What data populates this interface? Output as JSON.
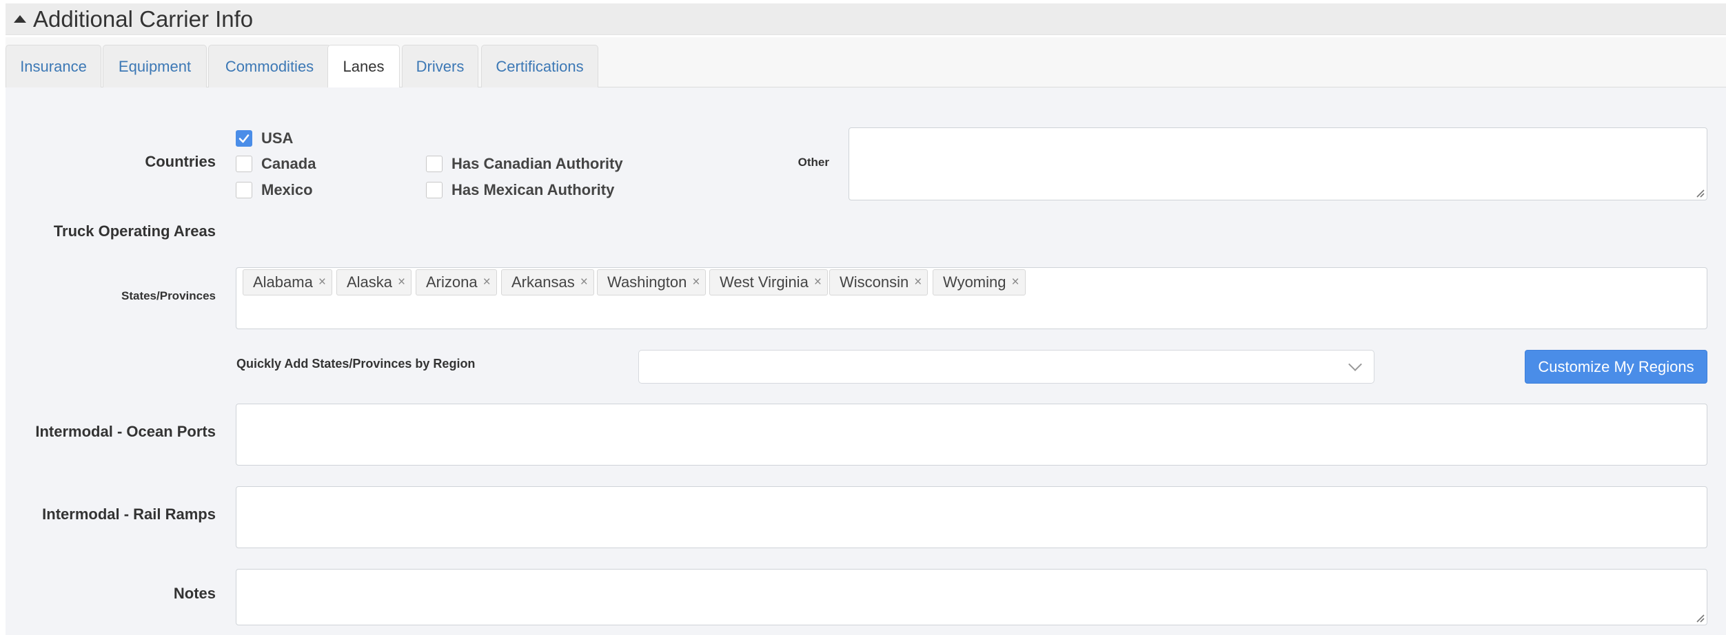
{
  "section": {
    "title": "Additional Carrier Info"
  },
  "tabs": [
    {
      "label": "Insurance"
    },
    {
      "label": "Equipment"
    },
    {
      "label": "Commodities"
    },
    {
      "label": "Lanes",
      "active": true
    },
    {
      "label": "Drivers"
    },
    {
      "label": "Certifications"
    }
  ],
  "countries": {
    "label": "Countries",
    "options": [
      {
        "label": "USA",
        "checked": true
      },
      {
        "label": "Canada",
        "checked": false
      },
      {
        "label": "Mexico",
        "checked": false
      },
      {
        "label": "Has Canadian Authority",
        "checked": false
      },
      {
        "label": "Has Mexican Authority",
        "checked": false
      }
    ],
    "other_label": "Other"
  },
  "truck_operating_areas": {
    "label": "Truck Operating Areas"
  },
  "states": {
    "label": "States/Provinces",
    "tags": [
      "Alabama",
      "Alaska",
      "Arizona",
      "Arkansas",
      "Washington",
      "West Virginia",
      "Wisconsin",
      "Wyoming"
    ],
    "remove_glyph": "×"
  },
  "region": {
    "label": "Quickly Add States/Provinces by Region",
    "selected": "",
    "button": "Customize My Regions"
  },
  "ocean_ports": {
    "label": "Intermodal - Ocean Ports"
  },
  "rail_ramps": {
    "label": "Intermodal - Rail Ramps"
  },
  "notes": {
    "label": "Notes"
  },
  "colors": {
    "accent": "#4a8de8",
    "link": "#3c78b5"
  }
}
